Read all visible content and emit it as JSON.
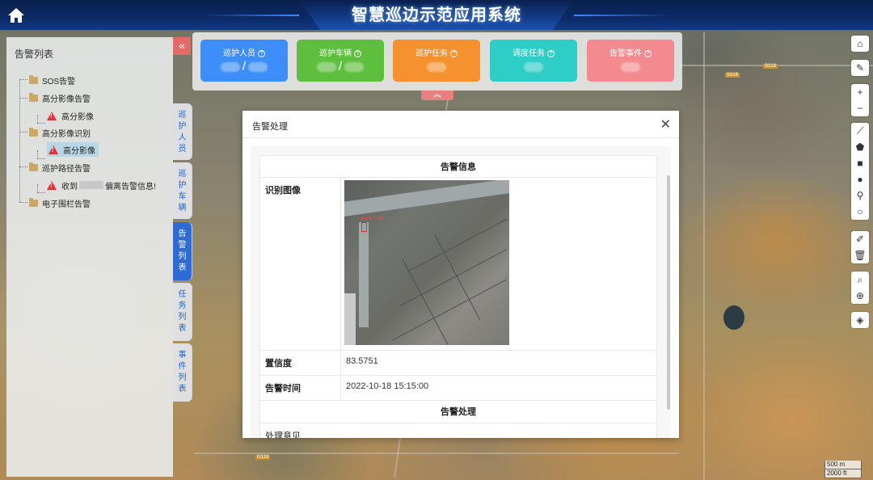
{
  "header": {
    "title": "智慧巡边示范应用系统"
  },
  "alert_panel": {
    "title": "告警列表",
    "tree": [
      {
        "label": "SOS告警"
      },
      {
        "label": "高分影像告警"
      },
      {
        "label": "高分影像",
        "level": 2,
        "icon": "warning-icon"
      },
      {
        "label": "高分影像识别"
      },
      {
        "label": "高分影像",
        "level": 2,
        "icon": "warning-icon",
        "selected": true
      },
      {
        "label": "巡护路径告警"
      },
      {
        "label_prefix": "收到",
        "label_suffix": "偏离告警信息!",
        "level": 2,
        "icon": "warning-icon"
      },
      {
        "label": "电子围栏告警"
      }
    ]
  },
  "side_tabs": [
    {
      "label": "巡护人员",
      "chars": [
        "巡",
        "护",
        "人",
        "员"
      ]
    },
    {
      "label": "巡护车辆",
      "chars": [
        "巡",
        "护",
        "车",
        "辆"
      ]
    },
    {
      "label": "告警列表",
      "chars": [
        "告",
        "警",
        "列",
        "表"
      ],
      "active": true
    },
    {
      "label": "任务列表",
      "chars": [
        "任",
        "务",
        "列",
        "表"
      ]
    },
    {
      "label": "事件列表",
      "chars": [
        "事",
        "件",
        "列",
        "表"
      ]
    }
  ],
  "stats": [
    {
      "label": "巡护人员",
      "value": "/",
      "color": "#3d8ef8"
    },
    {
      "label": "巡护车辆",
      "value": "/",
      "color": "#5dbf3d"
    },
    {
      "label": "巡护任务",
      "value": "",
      "color": "#f5922f"
    },
    {
      "label": "调度任务",
      "value": "",
      "color": "#2ecdc6"
    },
    {
      "label": "告警事件",
      "value": "",
      "color": "#f28a8f"
    }
  ],
  "modal": {
    "title": "告警处理",
    "section_info": "告警信息",
    "image_label": "识别图像",
    "detection_label": "plane 0.84",
    "confidence_label": "置信度",
    "confidence_value": "83.5751",
    "time_label": "告警时间",
    "time_value": "2022-10-18 15:15:00",
    "section_handle": "告警处理",
    "opinion_label": "处理意见"
  },
  "map": {
    "labels": [
      "S318",
      "S318",
      "G118"
    ],
    "scale": [
      "500 m",
      "2000 ft"
    ]
  },
  "colors": {
    "header_bg": "#0c2a66",
    "active_tab": "#2f6bd2",
    "collapse_btn": "#e46a6a"
  }
}
